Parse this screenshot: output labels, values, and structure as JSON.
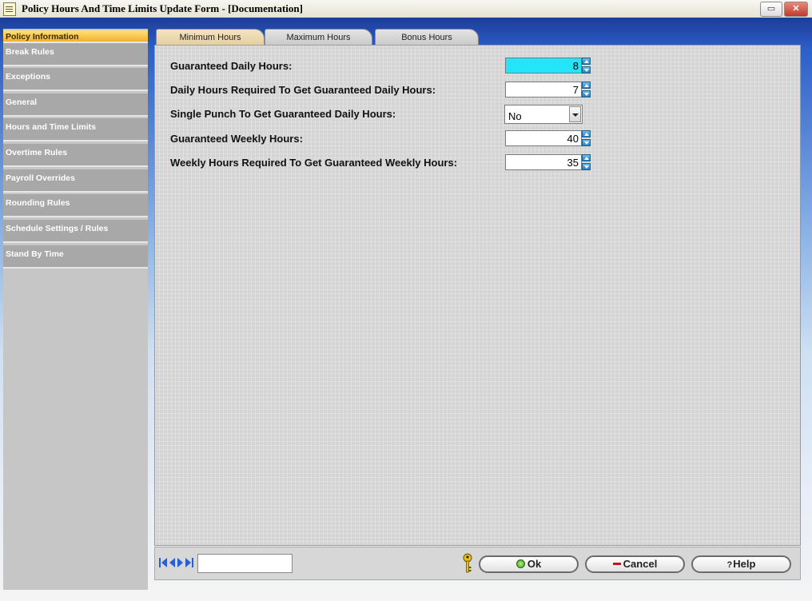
{
  "window": {
    "title": "Policy Hours And Time Limits Update Form - [Documentation]",
    "minimize": "▭",
    "close": "✕"
  },
  "sidebar": {
    "items": [
      {
        "label": "Policy Information",
        "active": true
      },
      {
        "label": "Break Rules"
      },
      {
        "label": "Exceptions"
      },
      {
        "label": "General"
      },
      {
        "label": "Hours and Time Limits"
      },
      {
        "label": "Overtime Rules"
      },
      {
        "label": "Payroll Overrides"
      },
      {
        "label": "Rounding Rules"
      },
      {
        "label": "Schedule Settings / Rules"
      },
      {
        "label": "Stand By Time"
      }
    ]
  },
  "tabs": [
    {
      "label": "Minimum Hours",
      "active": true
    },
    {
      "label": "Maximum Hours"
    },
    {
      "label": "Bonus Hours"
    }
  ],
  "form": {
    "guaranteed_daily": {
      "label": "Guaranteed Daily Hours:",
      "value": "8"
    },
    "daily_required": {
      "label": "Daily Hours Required To Get Guaranteed Daily Hours:",
      "value": "7"
    },
    "single_punch": {
      "label": "Single Punch To Get Guaranteed Daily Hours:",
      "value": "No"
    },
    "guaranteed_weekly": {
      "label": "Guaranteed Weekly Hours:",
      "value": "40"
    },
    "weekly_required": {
      "label": "Weekly Hours Required To Get Guaranteed Weekly Hours:",
      "value": "35"
    }
  },
  "footer": {
    "record_value": "",
    "ok_label": "Ok",
    "cancel_label": "Cancel",
    "help_label": "Help",
    "help_icon": "?"
  },
  "colors": {
    "focus_field": "#22e5f7",
    "active_sidebar": "#f2b02c",
    "active_tab": "#e4cf9f",
    "spin_button": "#2a7fbf"
  }
}
